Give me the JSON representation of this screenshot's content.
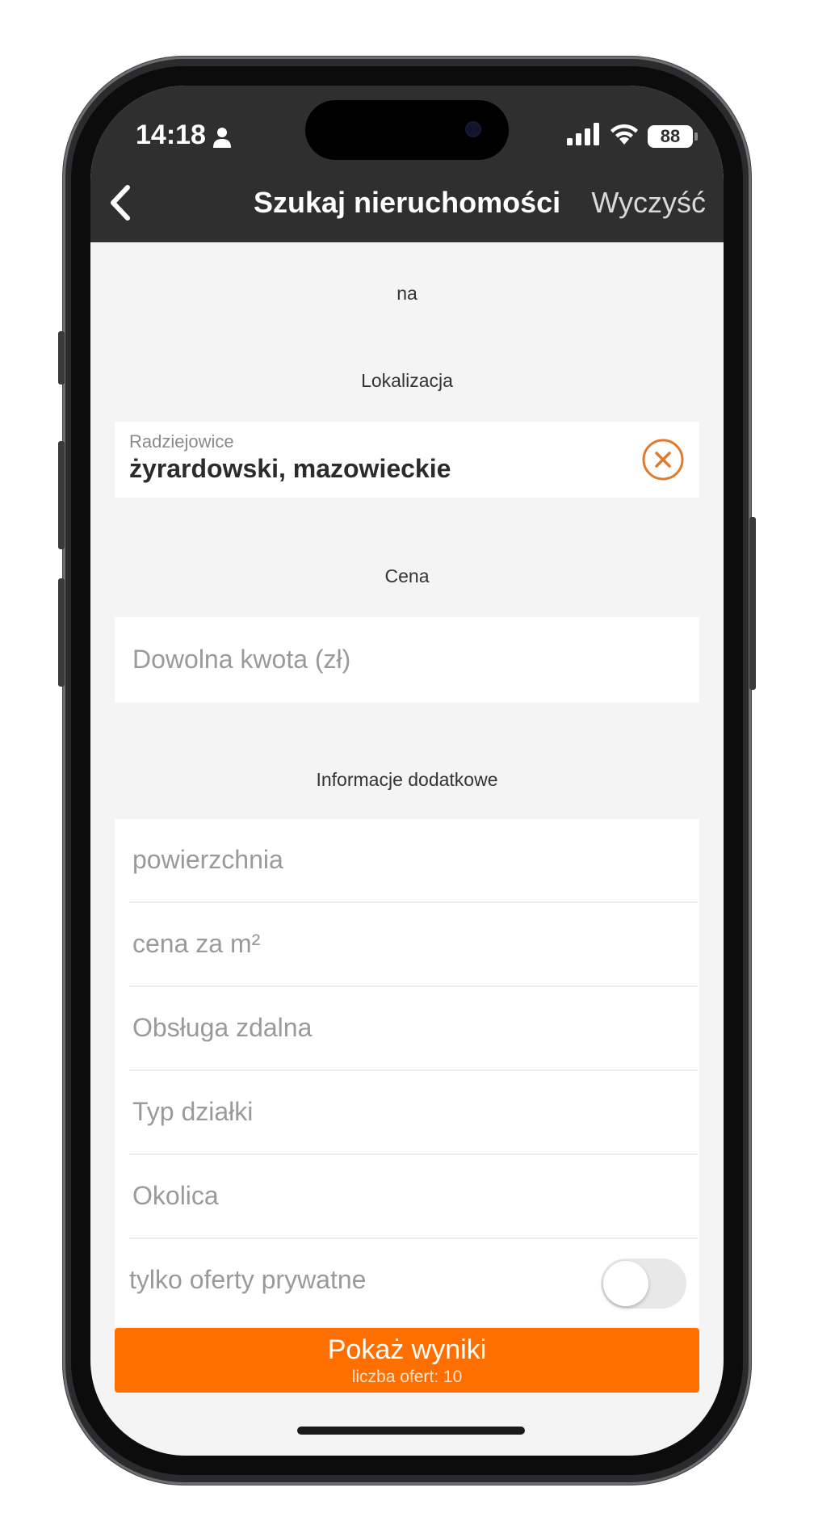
{
  "status_bar": {
    "time": "14:18",
    "battery": "88"
  },
  "nav": {
    "title": "Szukaj nieruchomości",
    "clear_label": "Wyczyść"
  },
  "form": {
    "transaction_label": "na",
    "location": {
      "section_label": "Lokalizacja",
      "city": "Radziejowice",
      "region": "żyrardowski, mazowieckie"
    },
    "price": {
      "section_label": "Cena",
      "placeholder": "Dowolna kwota (zł)"
    },
    "extra": {
      "section_label": "Informacje dodatkowe",
      "fields": [
        "powierzchnia",
        "cena za m²",
        "Obsługa zdalna",
        "Typ działki",
        "Okolica"
      ],
      "private_only": {
        "label": "tylko oferty prywatne",
        "enabled": false
      }
    }
  },
  "results_button": {
    "label": "Pokaż wyniki",
    "count_label": "liczba ofert: 10"
  },
  "colors": {
    "accent": "#ff6f00",
    "topbar": "#2f2f2f",
    "clear_icon": "#e07b2e",
    "background": "#f4f4f4"
  }
}
